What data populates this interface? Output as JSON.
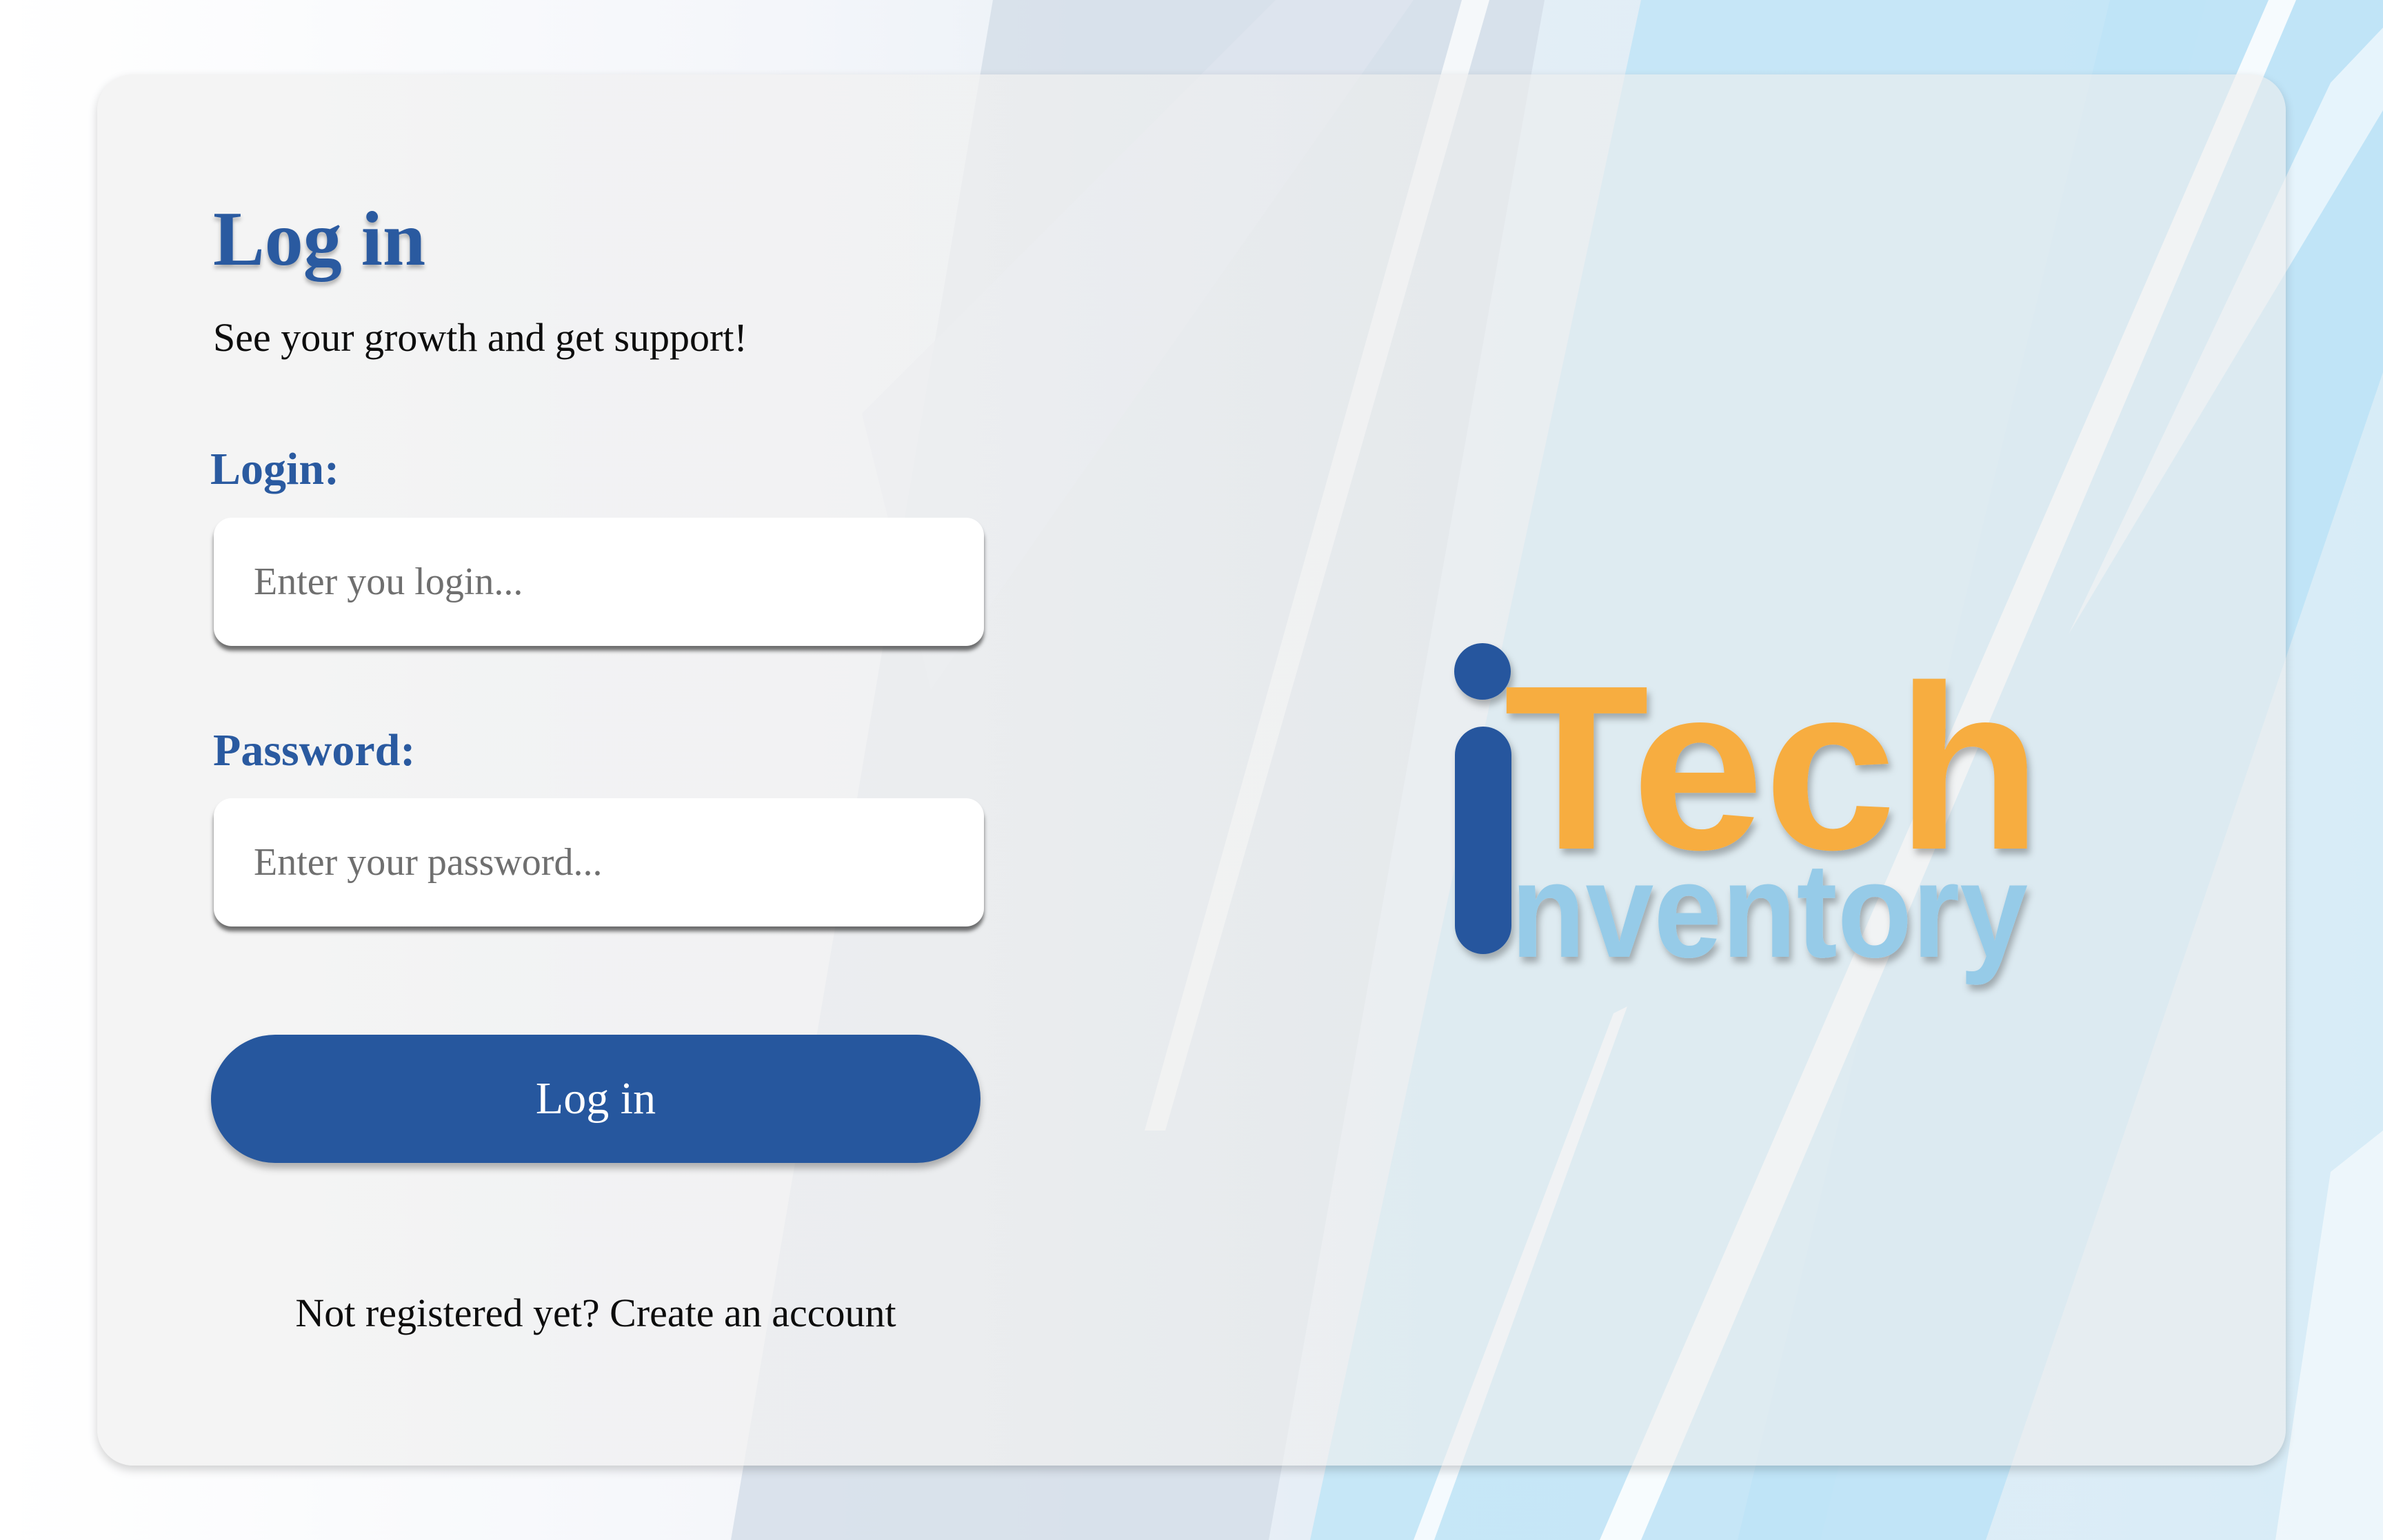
{
  "login_form": {
    "title": "Log in",
    "subtitle": "See your growth and get support!",
    "login_label": "Login:",
    "login_placeholder": "Enter you login...",
    "login_value": "",
    "password_label": "Password:",
    "password_placeholder": "Enter your password...",
    "password_value": "",
    "submit_label": "Log in",
    "register_prompt": "Not registered yet?",
    "register_link": "Create an account"
  },
  "logo": {
    "initial": "i",
    "word_top": "Tech",
    "word_bottom": "nventory"
  },
  "colors": {
    "primary": "#26579e",
    "heading": "#2a5aa0",
    "logo_orange": "#f7ad3f",
    "logo_light_blue": "#96cbe8",
    "logo_dark_blue": "#26579e"
  }
}
